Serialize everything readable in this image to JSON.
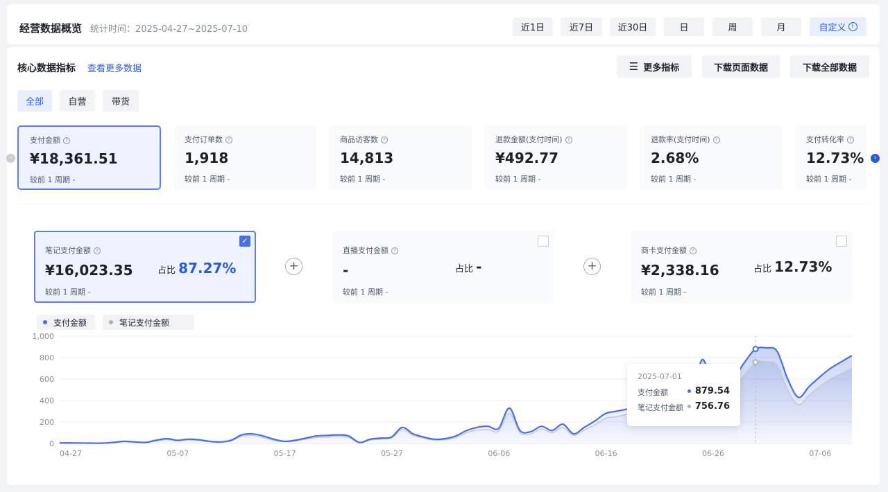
{
  "header": {
    "title": "经营数据概览",
    "stat_time": "统计时间：2025-04-27~2025-07-10",
    "ranges": [
      "近1日",
      "近7日",
      "近30日",
      "日",
      "周",
      "月"
    ],
    "custom_label": "自定义",
    "custom_icon": "info-icon"
  },
  "core": {
    "title": "核心数据指标",
    "more_link": "查看更多数据",
    "more_metrics": "更多指标",
    "download_page": "下载页面数据",
    "download_all": "下载全部数据"
  },
  "tabs": [
    "全部",
    "自营",
    "带货"
  ],
  "metrics": [
    {
      "label": "支付金额",
      "value": "¥18,361.51",
      "compare": "较前 1 周期  -"
    },
    {
      "label": "支付订单数",
      "value": "1,918",
      "compare": "较前 1 周期  -"
    },
    {
      "label": "商品访客数",
      "value": "14,813",
      "compare": "较前 1 周期  -"
    },
    {
      "label": "退款金额(支付时间)",
      "value": "¥492.77",
      "compare": "较前 1 周期  -"
    },
    {
      "label": "退款率(支付时间)",
      "value": "2.68%",
      "compare": "较前 1 周期  -"
    },
    {
      "label": "支付转化率",
      "value": "12.73%",
      "compare": "较前 1 周期  -"
    }
  ],
  "breakdown": [
    {
      "label": "笔记支付金额",
      "value": "¥16,023.35",
      "share_label": "占比",
      "share": "87.27%",
      "compare": "较前 1 周期  -",
      "checked": true
    },
    {
      "label": "直播支付金额",
      "value": "-",
      "share_label": "占比",
      "share": "-",
      "compare": "较前 1 周期  -",
      "checked": false
    },
    {
      "label": "商卡支付金额",
      "value": "¥2,338.16",
      "share_label": "占比",
      "share": "12.73%",
      "compare": "较前 1 周期  -",
      "checked": false
    }
  ],
  "tooltip": {
    "date": "2025-07-01",
    "rows": [
      {
        "name": "支付金额",
        "value": "879.54"
      },
      {
        "name": "笔记支付金额",
        "value": "756.76"
      }
    ]
  },
  "colors": {
    "accent": "#2a5bd7",
    "series1": "#4a6fe3",
    "series2": "#a9aeb8"
  },
  "chart_data": {
    "type": "area",
    "legend": [
      "支付金额",
      "笔记支付金额"
    ],
    "x_ticks": [
      "04-27",
      "05-07",
      "05-17",
      "05-27",
      "06-06",
      "06-16",
      "06-26",
      "07-06"
    ],
    "y_ticks": [
      "0",
      "200",
      "400",
      "600",
      "800",
      "1,000"
    ],
    "ylim": [
      0,
      1000
    ],
    "start_date": "2025-04-27",
    "x": [
      "04-27",
      "04-28",
      "04-29",
      "04-30",
      "05-01",
      "05-02",
      "05-03",
      "05-04",
      "05-05",
      "05-06",
      "05-07",
      "05-08",
      "05-09",
      "05-10",
      "05-11",
      "05-12",
      "05-13",
      "05-14",
      "05-15",
      "05-16",
      "05-17",
      "05-18",
      "05-19",
      "05-20",
      "05-21",
      "05-22",
      "05-23",
      "05-24",
      "05-25",
      "05-26",
      "05-27",
      "05-28",
      "05-29",
      "05-30",
      "05-31",
      "06-01",
      "06-02",
      "06-03",
      "06-04",
      "06-05",
      "06-06",
      "06-07",
      "06-08",
      "06-09",
      "06-10",
      "06-11",
      "06-12",
      "06-13",
      "06-14",
      "06-15",
      "06-16",
      "06-17",
      "06-18",
      "06-19",
      "06-20",
      "06-21",
      "06-22",
      "06-23",
      "06-24",
      "06-25",
      "06-26",
      "06-27",
      "06-28",
      "06-29",
      "06-30",
      "07-01",
      "07-02",
      "07-03",
      "07-04",
      "07-05",
      "07-06",
      "07-07",
      "07-08",
      "07-09",
      "07-10"
    ],
    "series": [
      {
        "name": "支付金额",
        "values": [
          5,
          5,
          4,
          3,
          3,
          10,
          20,
          15,
          10,
          30,
          45,
          30,
          40,
          35,
          20,
          15,
          30,
          80,
          90,
          70,
          40,
          20,
          30,
          50,
          70,
          75,
          80,
          70,
          10,
          40,
          50,
          60,
          150,
          90,
          60,
          40,
          45,
          70,
          120,
          150,
          160,
          140,
          330,
          120,
          110,
          160,
          120,
          180,
          90,
          150,
          210,
          280,
          300,
          320,
          340,
          230,
          380,
          480,
          420,
          400,
          780,
          550,
          600,
          620,
          760,
          880,
          890,
          860,
          600,
          430,
          530,
          620,
          700,
          760,
          820
        ]
      },
      {
        "name": "笔记支付金额",
        "values": [
          3,
          3,
          2,
          2,
          2,
          6,
          15,
          10,
          8,
          22,
          35,
          25,
          32,
          28,
          15,
          10,
          22,
          65,
          75,
          55,
          30,
          15,
          22,
          40,
          55,
          60,
          65,
          55,
          5,
          30,
          40,
          50,
          130,
          75,
          50,
          30,
          35,
          55,
          100,
          125,
          130,
          115,
          280,
          100,
          90,
          135,
          100,
          150,
          75,
          125,
          175,
          235,
          250,
          270,
          285,
          190,
          320,
          400,
          350,
          335,
          650,
          470,
          510,
          530,
          640,
          756,
          760,
          730,
          500,
          360,
          450,
          530,
          600,
          650,
          700
        ]
      }
    ]
  }
}
